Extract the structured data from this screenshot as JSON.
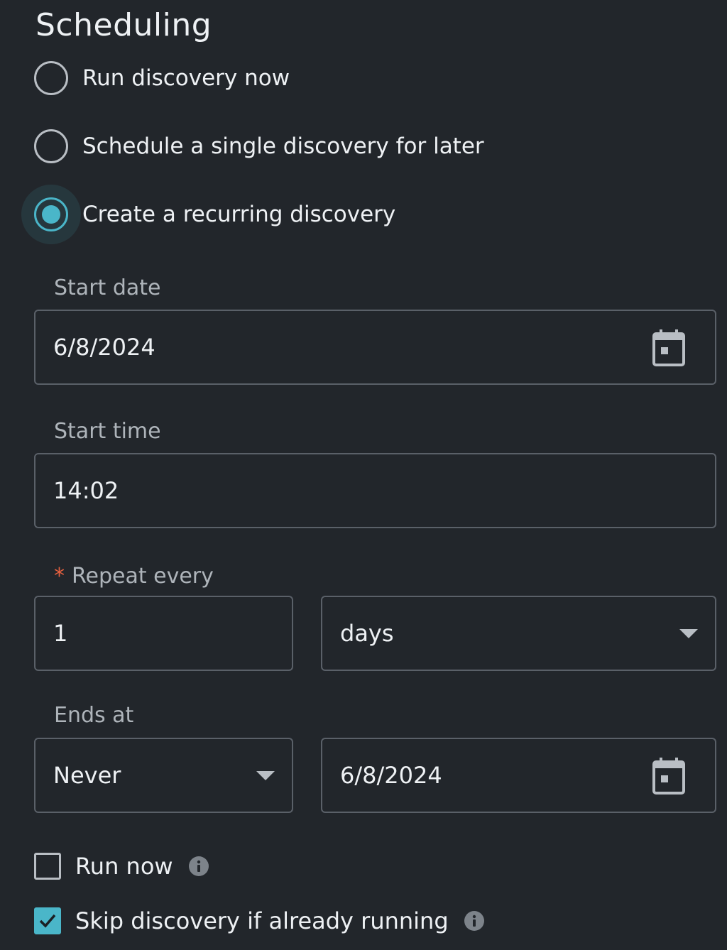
{
  "section": {
    "title": "Scheduling"
  },
  "schedule_options": [
    {
      "label": "Run discovery now",
      "selected": false
    },
    {
      "label": "Schedule a single discovery for later",
      "selected": false
    },
    {
      "label": "Create a recurring discovery",
      "selected": true
    }
  ],
  "start_date": {
    "label": "Start date",
    "value": "6/8/2024",
    "icon": "calendar-icon"
  },
  "start_time": {
    "label": "Start time",
    "value": "14:02"
  },
  "repeat_every": {
    "required_marker": "*",
    "label": "Repeat every",
    "interval_value": "1",
    "unit_value": "days"
  },
  "ends_at": {
    "label": "Ends at",
    "mode_value": "Never",
    "date_value": "6/8/2024",
    "icon": "calendar-icon"
  },
  "options": {
    "run_now": {
      "label": "Run now",
      "checked": false,
      "icon": "info-icon"
    },
    "skip_if_running": {
      "label": "Skip discovery if already running",
      "checked": true,
      "icon": "info-icon"
    }
  },
  "colors": {
    "background": "#22262b",
    "accent": "#4ab6c9",
    "required": "#e5603f",
    "border": "#5a6068"
  }
}
